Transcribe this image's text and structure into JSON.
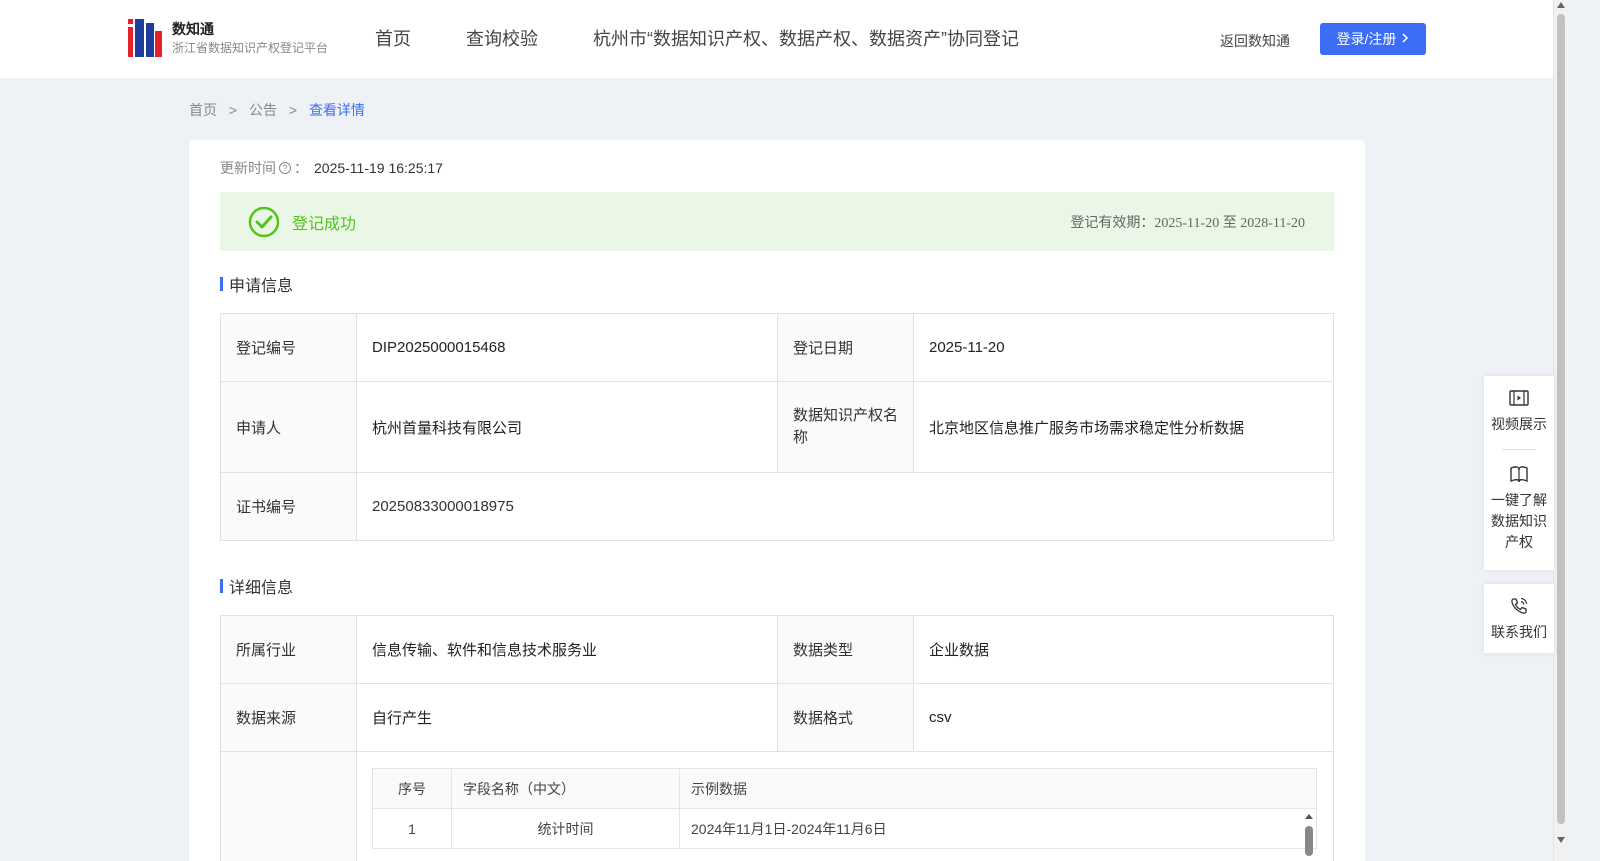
{
  "header": {
    "logo_name": "数知通",
    "logo_subtitle": "浙江省数据知识产权登记平台",
    "nav": [
      {
        "label": "首页"
      },
      {
        "label": "查询校验"
      },
      {
        "label": "杭州市“数据知识产权、数据产权、数据资产”协同登记"
      }
    ],
    "back_link": "返回数知通",
    "login_button": "登录/注册"
  },
  "breadcrumb": {
    "home": "首页",
    "sep1": ">",
    "notice": "公告",
    "sep2": ">",
    "current": "查看详情"
  },
  "update": {
    "label": "更新时间",
    "colon": "：",
    "value": "2025-11-19 16:25:17"
  },
  "status": {
    "text": "登记成功",
    "validity": "登记有效期：2025-11-20 至 2028-11-20",
    "color": "#52c41a"
  },
  "application": {
    "title": "申请信息",
    "reg_no_label": "登记编号",
    "reg_no": "DIP2025000015468",
    "reg_date_label": "登记日期",
    "reg_date": "2025-11-20",
    "applicant_label": "申请人",
    "applicant": "杭州首量科技有限公司",
    "ip_name_label": "数据知识产权名称",
    "ip_name": "北京地区信息推广服务市场需求稳定性分析数据",
    "cert_no_label": "证书编号",
    "cert_no": "20250833000018975"
  },
  "detail": {
    "title": "详细信息",
    "industry_label": "所属行业",
    "industry": "信息传输、软件和信息技术服务业",
    "data_type_label": "数据类型",
    "data_type": "企业数据",
    "source_label": "数据来源",
    "source": "自行产生",
    "format_label": "数据格式",
    "format": "csv",
    "fields_table": {
      "headers": [
        "序号",
        "字段名称（中文）",
        "示例数据"
      ],
      "rows": [
        [
          "1",
          "统计时间",
          "2024年11月1日-2024年11月6日"
        ]
      ]
    }
  },
  "float_menu": {
    "video": "视频展示",
    "learn": "一键了解数据知识产权",
    "contact": "联系我们"
  },
  "colors": {
    "accent": "#3b6ef5"
  }
}
